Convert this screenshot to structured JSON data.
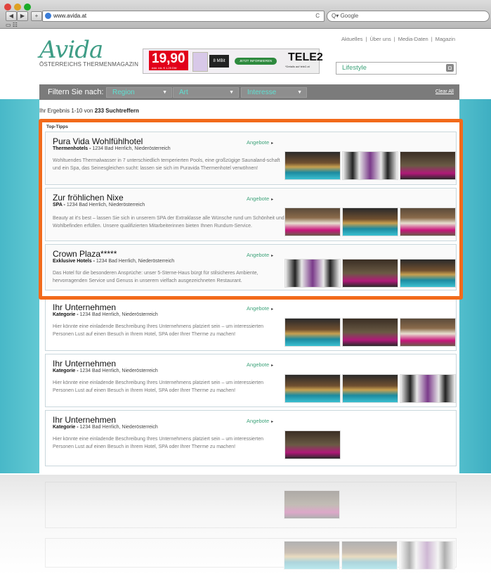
{
  "browser": {
    "url": "www.avida.at",
    "search_placeholder": "Q▾ Google",
    "nav_back": "◀",
    "nav_forward": "▶",
    "nav_add": "+",
    "reload": "C",
    "bookmarks_icons": "▭ ☷"
  },
  "header": {
    "logo": "Avida",
    "logo_sub": "ÖSTERREICHS THERMENMAGAZIN",
    "top_links": [
      "Aktuelles",
      "Über uns",
      "Media-Daten",
      "Magazin"
    ],
    "search_value": "Lifestyle",
    "ad": {
      "price": "19,90",
      "price_sup": "€*",
      "small": "exkl. ink. € 1,25 DW",
      "badge": "8 MBit",
      "cta": "JETZT INFORMIEREN",
      "brand": "TELE2",
      "brand_sub": "*Details auf tele2.at"
    }
  },
  "filters": {
    "label": "Filtern Sie nach:",
    "items": [
      {
        "label": "Region"
      },
      {
        "label": "Art"
      },
      {
        "label": "Interesse"
      }
    ],
    "clear": "Clear All"
  },
  "results": {
    "count_prefix": "Ihr Ergebnis 1-10 von",
    "count_bold": "233 Suchtreffern",
    "top_tips": "Top-Tipps",
    "angebote": "Angebote",
    "items": [
      {
        "title": "Pura Vida  Wohlfühlhotel",
        "category": "Thermenhotels -",
        "address": " 1234 Bad Herrlich, Niederösterreich",
        "desc": "Wohltuendes Thermalwasser in 7 unterschiedlich temperierten Pools, eine großzügige Saunaland-schaft und ein Spa, das Seinesgleichen sucht: lassen sie sich im Puravida Thermenhotel verwöhnen!"
      },
      {
        "title": "Zur fröhlichen Nixe",
        "category": "SPA -",
        "address": " 1234 Bad Herrlich, Niederösterreich",
        "desc": "Beauty at it's best – lassen Sie sich in unserem SPA der Extraklasse alle Wünsche rund um Schönheit und Wohlbefinden erfüllen. Unsere qualifizierten Mitarbeiterinnen bieten Ihnen Rundum-Service."
      },
      {
        "title": "Crown Plaza*****",
        "category": "Exklusive Hotels -",
        "address": " 1234 Bad Herrlich, Niederösterreich",
        "desc": "Das Hotel für die besonderen Ansprüche: unser 5-Sterne-Haus bürgt für stilsicheres Ambiente, hervorragenden Service und Genuss in unserem vielfach ausgezeichneten Restaurant."
      },
      {
        "title": "Ihr Unternehmen",
        "category": "Kategorie -",
        "address": " 1234 Bad Herrlich, Niederösterreich",
        "desc": "Hier könnte eine einladende Beschreibung Ihres Unternehmens platziert sein – um interessierten Personen Lust auf einen Besuch in Ihrem Hotel, SPA oder Ihrer Therme zu machen!"
      },
      {
        "title": "Ihr Unternehmen",
        "category": "Kategorie -",
        "address": " 1234 Bad Herrlich, Niederösterreich",
        "desc": "Hier könnte eine einladende Beschreibung Ihres Unternehmens platziert sein – um interessierten Personen Lust auf einen Besuch in Ihrem Hotel, SPA oder Ihrer Therme zu machen!"
      },
      {
        "title": "Ihr Unternehmen",
        "category": "Kategorie -",
        "address": " 1234 Bad Herrlich, Niederösterreich",
        "desc": "Hier könnte eine einladende Beschreibung Ihres Unternehmens platziert sein – um interessierten Personen Lust auf einen Besuch in Ihrem Hotel, SPA oder Ihrer Therme zu machen!"
      }
    ]
  },
  "colors": {
    "accent_green": "#3f9d86",
    "highlight": "#f26a1b",
    "filter_bar": "#7b7b7b",
    "water": "#48b8c8"
  }
}
